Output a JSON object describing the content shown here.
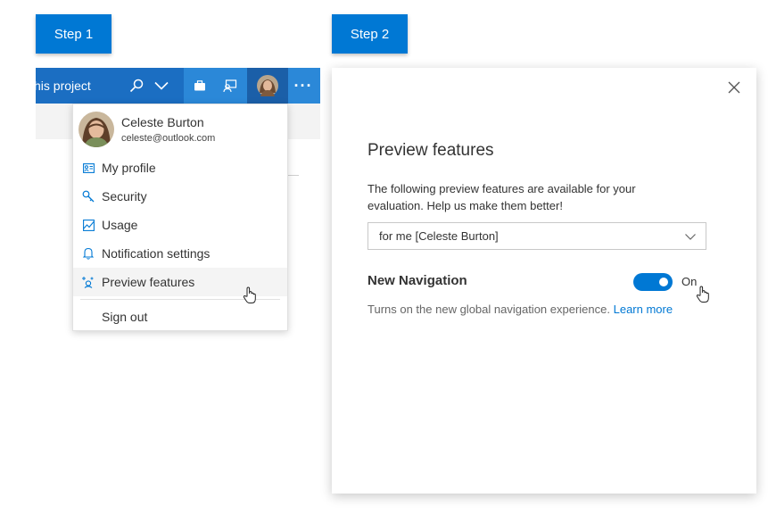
{
  "steps": {
    "step1": "Step 1",
    "step2": "Step 2"
  },
  "topbar": {
    "title_fragment": "his project",
    "icons": [
      "search-icon",
      "chevron-down-icon",
      "briefcase-icon",
      "chat-icon",
      "avatar",
      "more-icon"
    ],
    "more_label": "···",
    "color": "#1b6ec2"
  },
  "menu": {
    "user": {
      "name": "Celeste Burton",
      "email": "celeste@outlook.com"
    },
    "items": [
      {
        "label": "My profile",
        "icon": "contact-card-icon"
      },
      {
        "label": "Security",
        "icon": "key-icon"
      },
      {
        "label": "Usage",
        "icon": "chart-icon"
      },
      {
        "label": "Notification settings",
        "icon": "bell-icon"
      },
      {
        "label": "Preview features",
        "icon": "sparkle-icon",
        "active": true
      }
    ],
    "sign_out": "Sign out"
  },
  "panel": {
    "title": "Preview features",
    "description": "The following preview features are available for your evaluation. Help us make them better!",
    "scope_select": {
      "value": "for me [Celeste Burton]"
    },
    "feature": {
      "name": "New Navigation",
      "toggle_state": "On",
      "description": "Turns on the new global navigation experience.",
      "learn_more": "Learn more"
    }
  },
  "colors": {
    "accent": "#0078d4",
    "header": "#1b6ec2"
  }
}
